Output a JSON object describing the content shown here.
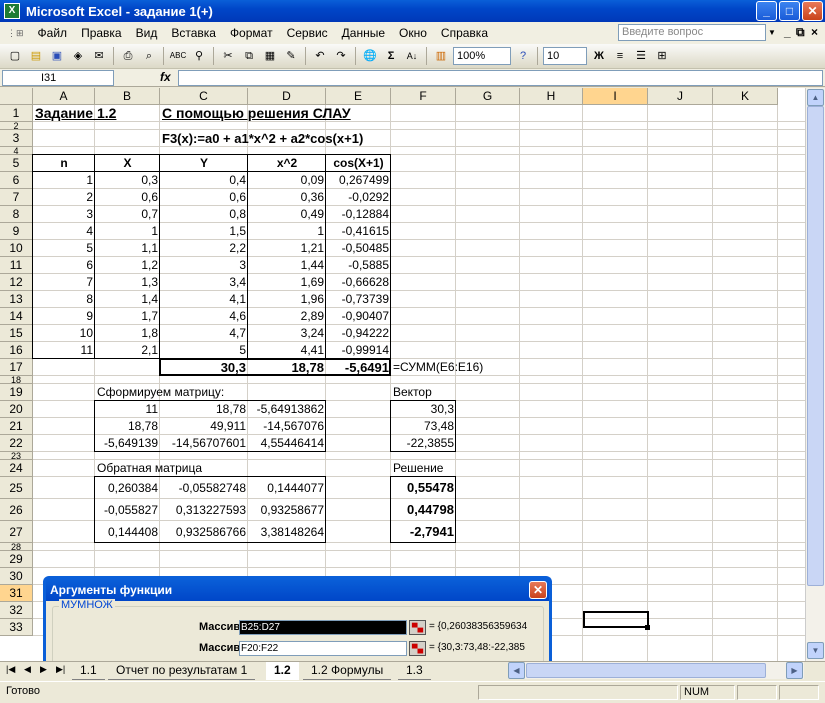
{
  "window": {
    "title": "Microsoft Excel - задание 1(+)",
    "min": "_",
    "max": "□",
    "close": "✕"
  },
  "menu": {
    "items": [
      "Файл",
      "Правка",
      "Вид",
      "Вставка",
      "Формат",
      "Сервис",
      "Данные",
      "Окно",
      "Справка"
    ],
    "ask_placeholder": "Введите вопрос"
  },
  "toolbar": {
    "zoom": "100%",
    "font_size": "10",
    "bold": "Ж",
    "sum": "Σ"
  },
  "formula_bar": {
    "name_box": "I31",
    "fx": "fx",
    "content": ""
  },
  "columns": [
    "A",
    "B",
    "C",
    "D",
    "E",
    "F",
    "G",
    "H",
    "I",
    "J",
    "K"
  ],
  "rows": [
    "1",
    "2",
    "3",
    "4",
    "5",
    "6",
    "7",
    "8",
    "9",
    "10",
    "11",
    "12",
    "13",
    "14",
    "15",
    "16",
    "17",
    "18",
    "19",
    "20",
    "21",
    "22",
    "23",
    "24",
    "25",
    "26",
    "27",
    "28",
    "29",
    "30",
    "31",
    "32",
    "33"
  ],
  "sheet": {
    "a1": "Задание 1.2",
    "c1": "С помощью решения СЛАУ",
    "c3": "F3(x):=a0 + a1*x^2 + a2*cos(x+1)",
    "headers": [
      "n",
      "X",
      "Y",
      "x^2",
      "cos(X+1)"
    ],
    "table": [
      [
        "1",
        "0,3",
        "0,4",
        "0,09",
        "0,267499"
      ],
      [
        "2",
        "0,6",
        "0,6",
        "0,36",
        "-0,0292"
      ],
      [
        "3",
        "0,7",
        "0,8",
        "0,49",
        "-0,12884"
      ],
      [
        "4",
        "1",
        "1,5",
        "1",
        "-0,41615"
      ],
      [
        "5",
        "1,1",
        "2,2",
        "1,21",
        "-0,50485"
      ],
      [
        "6",
        "1,2",
        "3",
        "1,44",
        "-0,5885"
      ],
      [
        "7",
        "1,3",
        "3,4",
        "1,69",
        "-0,66628"
      ],
      [
        "8",
        "1,4",
        "4,1",
        "1,96",
        "-0,73739"
      ],
      [
        "9",
        "1,7",
        "4,6",
        "2,89",
        "-0,90407"
      ],
      [
        "10",
        "1,8",
        "4,7",
        "3,24",
        "-0,94222"
      ],
      [
        "11",
        "2,1",
        "5",
        "4,41",
        "-0,99914"
      ]
    ],
    "sums": {
      "c17": "30,3",
      "d17": "18,78",
      "e17": "-5,6491",
      "f17": "=СУММ(E6:E16)"
    },
    "matrix_label": "Сформируем матрицу:",
    "matrix": [
      [
        "11",
        "18,78",
        "-5,64913862"
      ],
      [
        "18,78",
        "49,911",
        "-14,567076"
      ],
      [
        "-5,649139",
        "-14,56707601",
        "4,55446414"
      ]
    ],
    "vector_label": "Вектор",
    "vector": [
      "30,3",
      "73,48",
      "-22,3855"
    ],
    "inverse_label": "Обратная матрица",
    "inverse": [
      [
        "0,260384",
        "-0,05582748",
        "0,1444077"
      ],
      [
        "-0,055827",
        "0,313227593",
        "0,93258677"
      ],
      [
        "0,144408",
        "0,932586766",
        "3,38148264"
      ]
    ],
    "solution_label": "Решение",
    "solution": [
      "0,55478",
      "0,44798",
      "-2,7941"
    ]
  },
  "dialog": {
    "title": "Аргументы функции",
    "function": "МУМНОЖ",
    "arg1_label": "Массив1",
    "arg1_value": "B25:D27",
    "arg1_result": "= {0,26038356359634",
    "arg2_label": "Массив2",
    "arg2_value": "F20:F22",
    "arg2_result": "= {30,3:73,48:-22,385"
  },
  "tabs": [
    "1.1",
    "Отчет по результатам 1",
    "1.2",
    "1.2 Формулы",
    "1.3"
  ],
  "active_tab": "1.2",
  "status": {
    "left": "Готово",
    "num": "NUM"
  }
}
